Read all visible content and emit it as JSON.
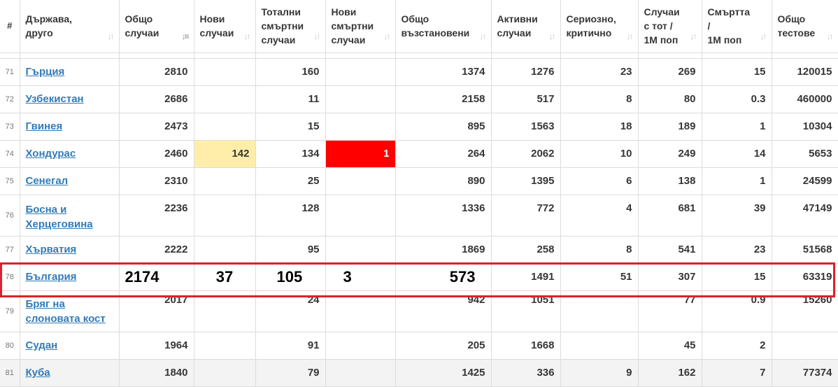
{
  "headers": {
    "num": "#",
    "country": "Държава,\nдруго",
    "total_cases": "Общо\nслучаи",
    "new_cases": "Нови\nслучаи",
    "total_deaths": "Тотални\nсмъртни\nслучаи",
    "new_deaths": "Нови\nсмъртни\nслучаи",
    "total_recovered": "Общо\nвъзстановени",
    "active_cases": "Активни\nслучаи",
    "serious_critical": "Сериозно,\nкритично",
    "cases_per_1m": "Случаи\nс тот /\n1М поп",
    "deaths_per_1m": "Смъртта\n/\n1М поп",
    "total_tests": "Общо\nтестове"
  },
  "sort_icons": {
    "default": "↓↑",
    "active": "↓≡"
  },
  "rows": [
    {
      "idx": "71",
      "country": "Гърция",
      "total_cases": "2810",
      "new_cases": "",
      "total_deaths": "160",
      "new_deaths": "",
      "total_recovered": "1374",
      "active_cases": "1276",
      "serious": "23",
      "per_1m": "269",
      "deaths_1m": "15",
      "tests": "120015"
    },
    {
      "idx": "72",
      "country": "Узбекистан",
      "total_cases": "2686",
      "new_cases": "",
      "total_deaths": "11",
      "new_deaths": "",
      "total_recovered": "2158",
      "active_cases": "517",
      "serious": "8",
      "per_1m": "80",
      "deaths_1m": "0.3",
      "tests": "460000"
    },
    {
      "idx": "73",
      "country": "Гвинея",
      "total_cases": "2473",
      "new_cases": "",
      "total_deaths": "15",
      "new_deaths": "",
      "total_recovered": "895",
      "active_cases": "1563",
      "serious": "18",
      "per_1m": "189",
      "deaths_1m": "1",
      "tests": "10304"
    },
    {
      "idx": "74",
      "country": "Хондурас",
      "total_cases": "2460",
      "new_cases": "142",
      "total_deaths": "134",
      "new_deaths": "1",
      "total_recovered": "264",
      "active_cases": "2062",
      "serious": "10",
      "per_1m": "249",
      "deaths_1m": "14",
      "tests": "5653"
    },
    {
      "idx": "75",
      "country": "Сенегал",
      "total_cases": "2310",
      "new_cases": "",
      "total_deaths": "25",
      "new_deaths": "",
      "total_recovered": "890",
      "active_cases": "1395",
      "serious": "6",
      "per_1m": "138",
      "deaths_1m": "1",
      "tests": "24599"
    },
    {
      "idx": "76",
      "country": "Босна и Херцеговина",
      "total_cases": "2236",
      "new_cases": "",
      "total_deaths": "128",
      "new_deaths": "",
      "total_recovered": "1336",
      "active_cases": "772",
      "serious": "4",
      "per_1m": "681",
      "deaths_1m": "39",
      "tests": "47149"
    },
    {
      "idx": "77",
      "country": "Хърватия",
      "total_cases": "2222",
      "new_cases": "",
      "total_deaths": "95",
      "new_deaths": "",
      "total_recovered": "1869",
      "active_cases": "258",
      "serious": "8",
      "per_1m": "541",
      "deaths_1m": "23",
      "tests": "51568"
    },
    {
      "idx": "78",
      "country": "България",
      "total_cases": "2174",
      "new_cases": "37",
      "total_deaths": "105",
      "new_deaths": "3",
      "total_recovered": "573",
      "active_cases": "1491",
      "serious": "51",
      "per_1m": "307",
      "deaths_1m": "15",
      "tests": "63319"
    },
    {
      "idx": "79",
      "country": "Бряг на слоновата кост",
      "total_cases": "2017",
      "new_cases": "",
      "total_deaths": "24",
      "new_deaths": "",
      "total_recovered": "942",
      "active_cases": "1051",
      "serious": "",
      "per_1m": "77",
      "deaths_1m": "0.9",
      "tests": "15260"
    },
    {
      "idx": "80",
      "country": "Судан",
      "total_cases": "1964",
      "new_cases": "",
      "total_deaths": "91",
      "new_deaths": "",
      "total_recovered": "205",
      "active_cases": "1668",
      "serious": "",
      "per_1m": "45",
      "deaths_1m": "2",
      "tests": ""
    },
    {
      "idx": "81",
      "country": "Куба",
      "total_cases": "1840",
      "new_cases": "",
      "total_deaths": "79",
      "new_deaths": "",
      "total_recovered": "1425",
      "active_cases": "336",
      "serious": "9",
      "per_1m": "162",
      "deaths_1m": "7",
      "tests": "77374"
    }
  ],
  "colors": {
    "link": "#337ab7",
    "new_cases_highlight": "#ffeeaa",
    "new_deaths_highlight": "#ff0000",
    "annotation_box": "#d9232d"
  }
}
